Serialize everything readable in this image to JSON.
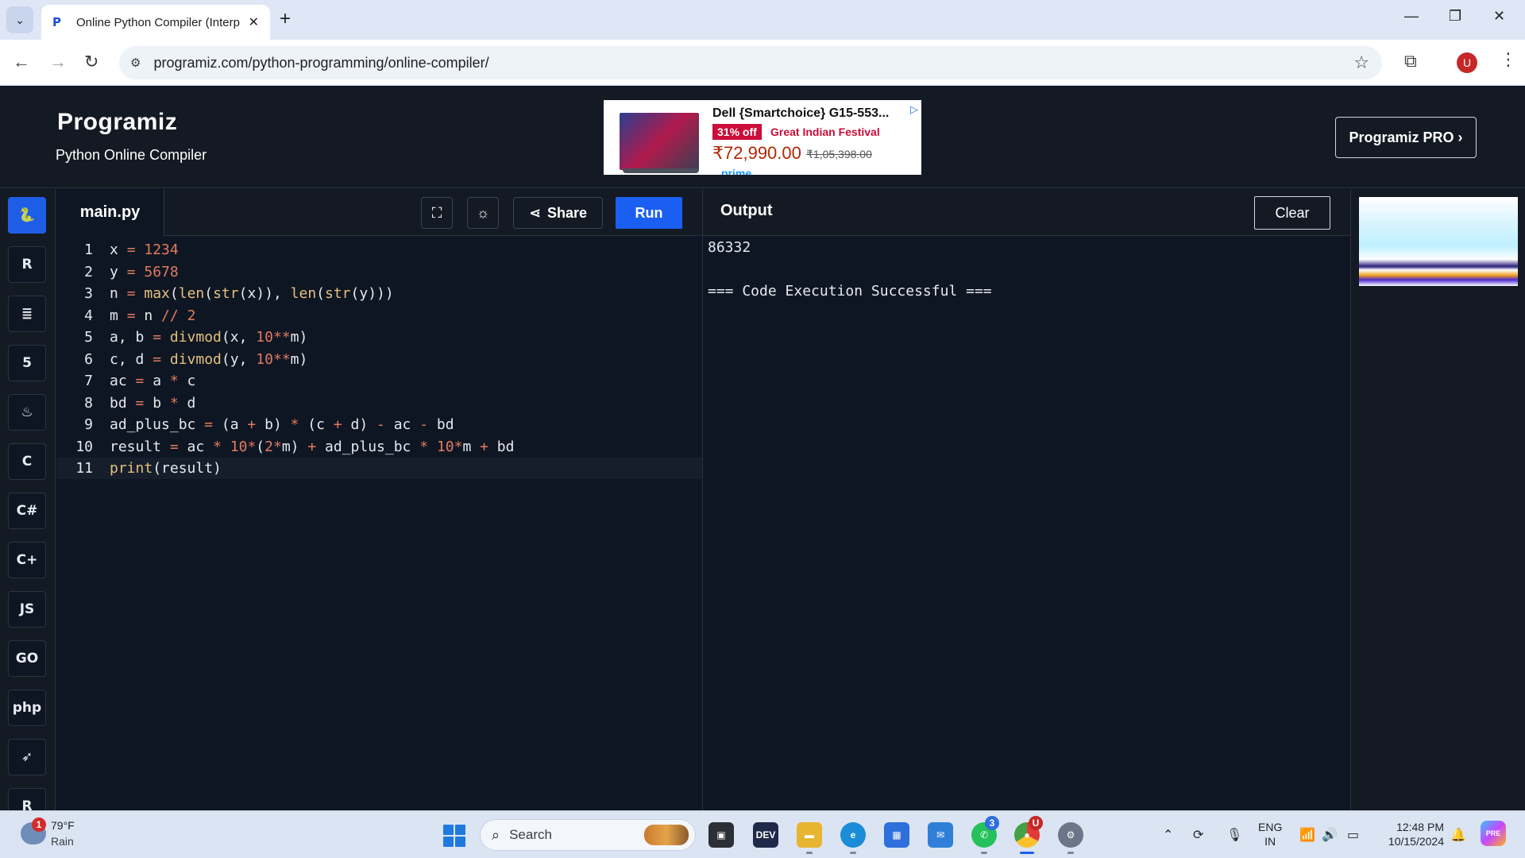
{
  "browser": {
    "tab_title": "Online Python Compiler (Interp",
    "tab_favicon": "P",
    "url": "programiz.com/python-programming/online-compiler/",
    "profile_initial": "U"
  },
  "header": {
    "logo": "Programiz",
    "subtitle": "Python Online Compiler",
    "pro_button": "Programiz PRO ›"
  },
  "ad": {
    "title": "Dell {Smartchoice} G15-553...",
    "discount": "31% off",
    "festival": "Great Indian Festival",
    "price": "₹72,990.00",
    "mrp": "₹1,05,398.00",
    "prime": "prime"
  },
  "rail": {
    "items": [
      {
        "icon": "python-icon",
        "glyph": "🐍",
        "active": true
      },
      {
        "icon": "r-icon",
        "glyph": "R"
      },
      {
        "icon": "sql-icon",
        "glyph": "≣"
      },
      {
        "icon": "html-icon",
        "glyph": "5"
      },
      {
        "icon": "java-icon",
        "glyph": "♨"
      },
      {
        "icon": "c-icon",
        "glyph": "C"
      },
      {
        "icon": "csharp-icon",
        "glyph": "C#"
      },
      {
        "icon": "cpp-icon",
        "glyph": "C+"
      },
      {
        "icon": "javascript-icon",
        "glyph": "JS"
      },
      {
        "icon": "go-icon",
        "glyph": "GO"
      },
      {
        "icon": "php-icon",
        "glyph": "php"
      },
      {
        "icon": "swift-icon",
        "glyph": "➶"
      },
      {
        "icon": "rust-icon",
        "glyph": "R"
      }
    ]
  },
  "editor": {
    "file_name": "main.py",
    "share_label": "Share",
    "run_label": "Run",
    "active_line": 11,
    "lines": [
      {
        "n": "1",
        "html": "x <span class=\"op\">=</span> <span class=\"num\">1234</span>"
      },
      {
        "n": "2",
        "html": "y <span class=\"op\">=</span> <span class=\"num\">5678</span>"
      },
      {
        "n": "3",
        "html": "n <span class=\"op\">=</span> <span class=\"fn\">max</span>(<span class=\"fn\">len</span>(<span class=\"fn\">str</span>(x)), <span class=\"fn\">len</span>(<span class=\"fn\">str</span>(y)))"
      },
      {
        "n": "4",
        "html": "m <span class=\"op\">=</span> n <span class=\"op\">//</span> <span class=\"num\">2</span>"
      },
      {
        "n": "5",
        "html": "a, b <span class=\"op\">=</span> <span class=\"fn\">divmod</span>(x, <span class=\"num\">10</span><span class=\"op\">**</span>m)"
      },
      {
        "n": "6",
        "html": "c, d <span class=\"op\">=</span> <span class=\"fn\">divmod</span>(y, <span class=\"num\">10</span><span class=\"op\">**</span>m)"
      },
      {
        "n": "7",
        "html": "ac <span class=\"op\">=</span> a <span class=\"op\">*</span> c"
      },
      {
        "n": "8",
        "html": "bd <span class=\"op\">=</span> b <span class=\"op\">*</span> d"
      },
      {
        "n": "9",
        "html": "ad_plus_bc <span class=\"op\">=</span> (a <span class=\"op\">+</span> b) <span class=\"op\">*</span> (c <span class=\"op\">+</span> d) <span class=\"op\">-</span> ac <span class=\"op\">-</span> bd"
      },
      {
        "n": "10",
        "html": "result <span class=\"op\">=</span> ac <span class=\"op\">*</span> <span class=\"num\">10</span><span class=\"op\">*</span>(<span class=\"num\">2</span><span class=\"op\">*</span>m) <span class=\"op\">+</span> ad_plus_bc <span class=\"op\">*</span> <span class=\"num\">10</span><span class=\"op\">*</span>m <span class=\"op\">+</span> bd"
      },
      {
        "n": "11",
        "html": "<span class=\"fn\">print</span>(result)"
      }
    ]
  },
  "output": {
    "title": "Output",
    "clear_label": "Clear",
    "lines": [
      "86332",
      "",
      "=== Code Execution Successful ==="
    ]
  },
  "taskbar": {
    "weather_badge": "1",
    "temperature": "79°F",
    "condition": "Rain",
    "search_placeholder": "Search",
    "lang_top": "ENG",
    "lang_bottom": "IN",
    "time": "12:48 PM",
    "date": "10/15/2024",
    "whatsapp_badge": "3",
    "chrome_badge": "U",
    "copilot_label": "PRE"
  }
}
